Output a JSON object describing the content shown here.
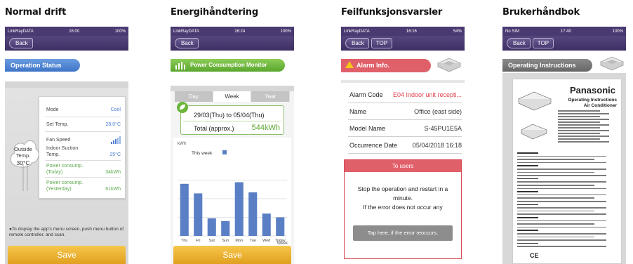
{
  "panels": [
    {
      "caption": "Normal drift",
      "status": {
        "carrier": "LinkRayDATA",
        "time": "16:00",
        "battery": "100%"
      },
      "nav": {
        "back": "Back"
      },
      "section_title": "Operation Status",
      "outside": {
        "label": "Outside\nTemp.",
        "value": "30°C"
      },
      "rows": [
        {
          "label": "Mode",
          "value": "Cool"
        },
        {
          "label": "Set Temp.",
          "value": "28.0°C"
        },
        {
          "label": "Fan Speed",
          "value": ""
        },
        {
          "label": "Indoor Suction\nTemp.",
          "value": "25°C"
        },
        {
          "label": "Power consump.\n(Today)",
          "value": "34kWh"
        },
        {
          "label": "Power consump.\n(Yesterday)",
          "value": "61kWh"
        }
      ],
      "note": "●To display the app's menu screen, push menu button of remote controller, and scan.",
      "save": "Save"
    },
    {
      "caption": "Energihåndtering",
      "status": {
        "carrier": "LinkRayDATA",
        "time": "16:24",
        "battery": "100%"
      },
      "nav": {
        "back": "Back"
      },
      "section_title": "Power Consumption Monitor",
      "tabs": [
        "Day",
        "Week",
        "Year"
      ],
      "active_tab": "Week",
      "range": "29/03(Thu) to 05/04(Thu)",
      "total_label": "Total (approx.)",
      "total_value": "544kWh",
      "save": "Save"
    },
    {
      "caption": "Feilfunksjonsvarsler",
      "status": {
        "carrier": "LinkRayDATA",
        "time": "16:16",
        "battery": "54%"
      },
      "nav": {
        "back": "Back",
        "top": "TOP"
      },
      "section_title": "Alarm Info.",
      "rows": [
        {
          "label": "Alarm Code",
          "value": "E04 Indoor unit recepti..."
        },
        {
          "label": "Name",
          "value": "Office (east side)"
        },
        {
          "label": "Model Name",
          "value": "S-45PU1E5A"
        },
        {
          "label": "Occurrence Date",
          "value": "05/04/2018 16:18"
        }
      ],
      "users_title": "To users",
      "users_message": "Stop the operation and restart in a minute.\nIf the error does not occur any",
      "users_button": "Tap here, if the error reoccurs."
    },
    {
      "caption": "Brukerhåndbok",
      "status": {
        "carrier": "No SIM",
        "time": "17:40",
        "battery": "100%"
      },
      "nav": {
        "back": "Back",
        "top": "TOP"
      },
      "section_title": "Operating Instructions",
      "doc_brand": "Panasonic",
      "doc_title": "Operating Instructions\nAir Conditioner"
    }
  ],
  "chart_data": {
    "type": "bar",
    "title": "",
    "legend": [
      "This week"
    ],
    "ylabel": "kWh",
    "xlabel": "Week",
    "categories": [
      "Thu",
      "Fri",
      "Sat",
      "Sun",
      "Mon",
      "Tue",
      "Wed",
      "Today"
    ],
    "values": [
      98,
      80,
      33,
      28,
      101,
      82,
      42,
      35
    ],
    "ylim": [
      0,
      140
    ],
    "bar_color": "#5a7fc4"
  }
}
